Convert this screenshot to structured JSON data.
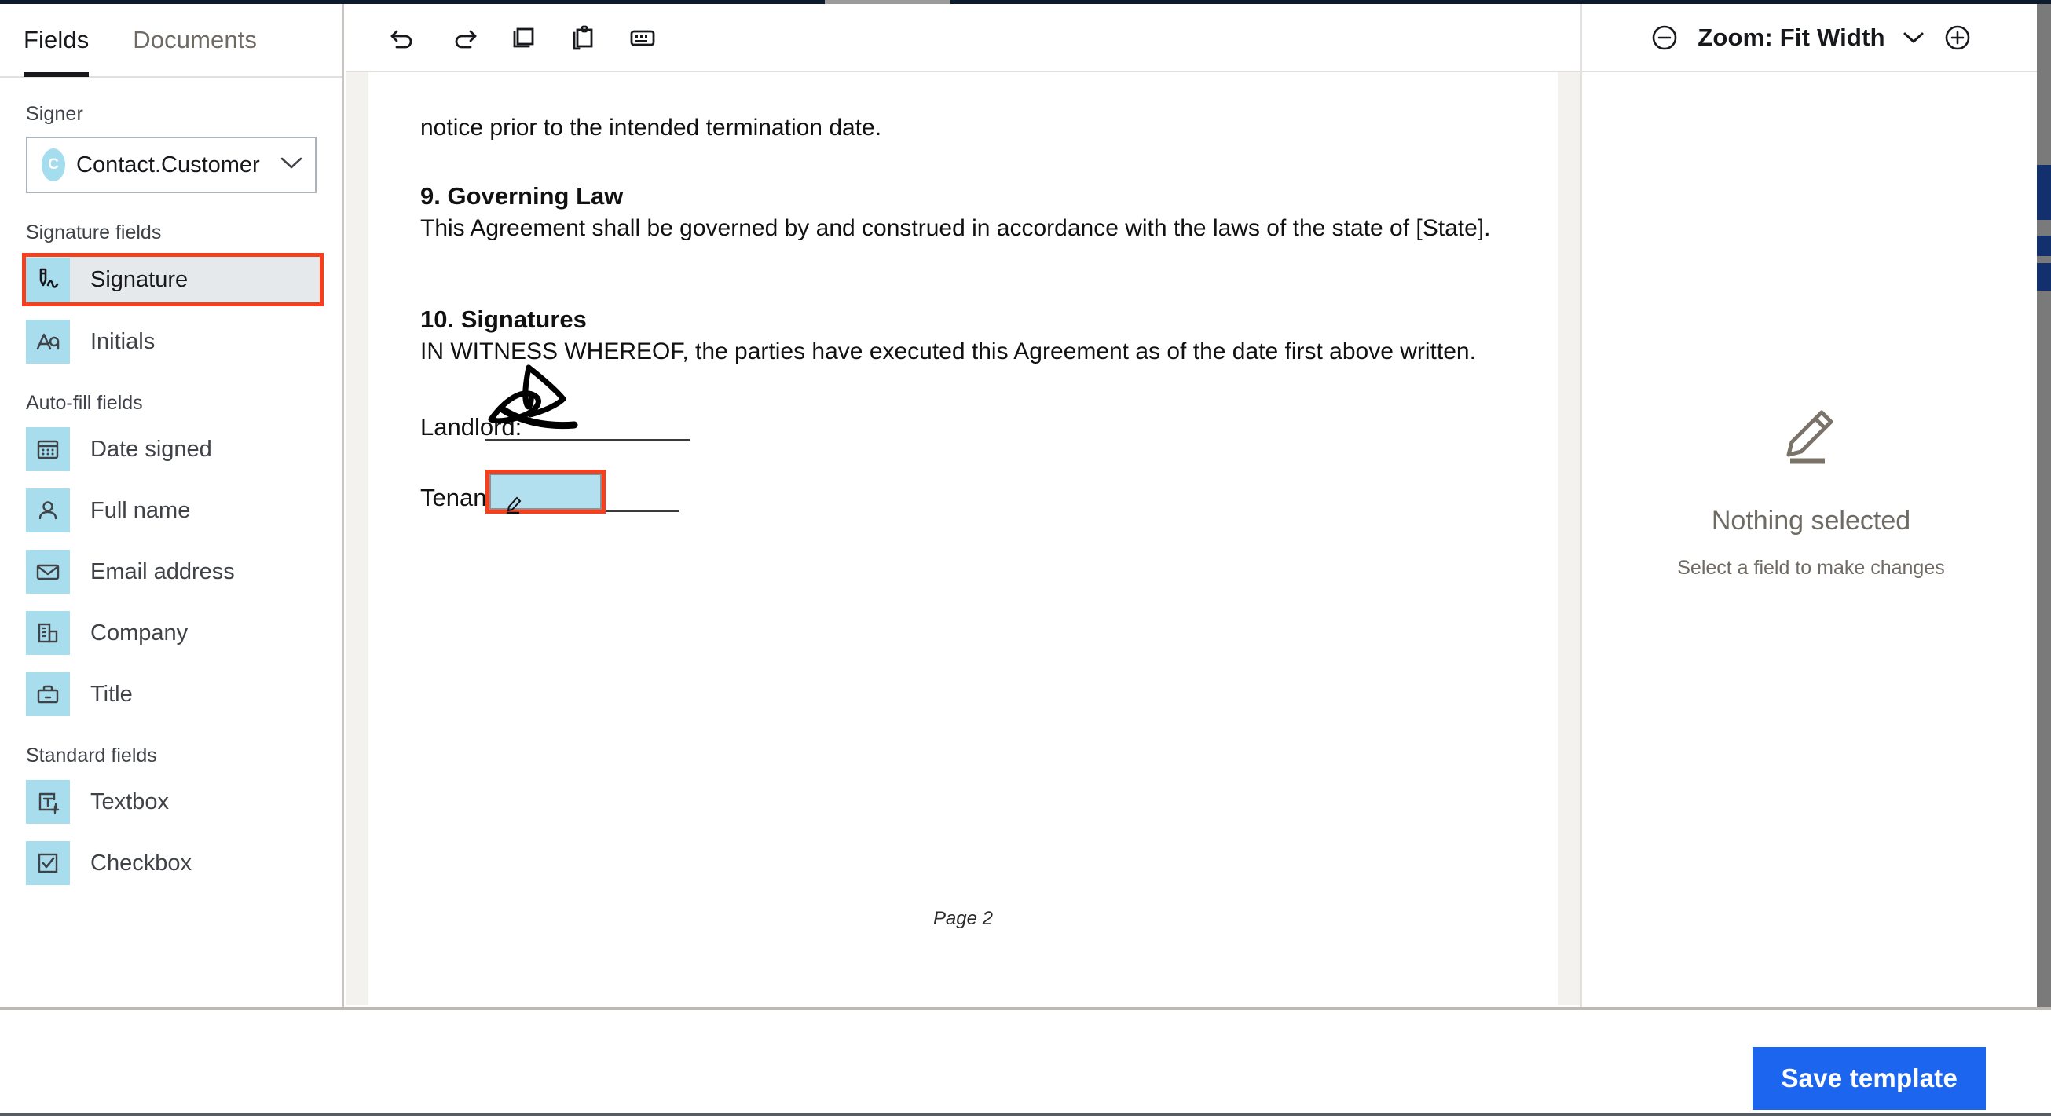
{
  "sidebar": {
    "tabs": [
      {
        "label": "Fields",
        "active": true
      },
      {
        "label": "Documents",
        "active": false
      }
    ],
    "signer_label": "Signer",
    "signer": {
      "avatar_initial": "C",
      "value": "Contact.Customer",
      "avatar_color": "#a3ddee"
    },
    "groups": [
      {
        "title": "Signature fields",
        "fields": [
          {
            "label": "Signature",
            "icon": "signature-icon",
            "selected": true
          },
          {
            "label": "Initials",
            "icon": "initials-icon",
            "selected": false
          }
        ]
      },
      {
        "title": "Auto-fill fields",
        "fields": [
          {
            "label": "Date signed",
            "icon": "calendar-icon",
            "selected": false
          },
          {
            "label": "Full name",
            "icon": "person-icon",
            "selected": false
          },
          {
            "label": "Email address",
            "icon": "envelope-icon",
            "selected": false
          },
          {
            "label": "Company",
            "icon": "building-icon",
            "selected": false
          },
          {
            "label": "Title",
            "icon": "briefcase-icon",
            "selected": false
          }
        ]
      },
      {
        "title": "Standard fields",
        "fields": [
          {
            "label": "Textbox",
            "icon": "textbox-icon",
            "selected": false
          },
          {
            "label": "Checkbox",
            "icon": "checkbox-icon",
            "selected": false
          }
        ]
      }
    ],
    "selection_highlight_color": "#f4401f",
    "field_icon_bg": "#a8ddee"
  },
  "toolbar": {
    "buttons": [
      {
        "name": "undo",
        "tooltip": "Undo"
      },
      {
        "name": "redo",
        "tooltip": "Redo"
      },
      {
        "name": "copy",
        "tooltip": "Copy"
      },
      {
        "name": "paste",
        "tooltip": "Paste"
      },
      {
        "name": "keyboard",
        "tooltip": "Keyboard shortcuts"
      }
    ]
  },
  "zoom": {
    "minus_label": "−",
    "plus_label": "+",
    "label": "Zoom: Fit Width"
  },
  "document": {
    "top_partial_line": "notice prior to the intended termination date.",
    "sections": [
      {
        "heading": "9. Governing Law",
        "body": "This Agreement shall be governed by and construed in accordance with the laws of the state of [State]."
      },
      {
        "heading": "10. Signatures",
        "body": "IN WITNESS WHEREOF, the parties have executed this Agreement as of the date first above written."
      }
    ],
    "signature_lines": [
      {
        "label": "Landlord:",
        "has_ink": true
      },
      {
        "label": "Tenant:",
        "has_ink": false,
        "has_field": true
      }
    ],
    "footer": "Page 2"
  },
  "right_panel": {
    "empty_icon": "pencil-underline-icon",
    "empty_title": "Nothing selected",
    "empty_subtitle": "Select a field to make changes"
  },
  "bottom_bar": {
    "save_label": "Save template",
    "save_color": "#1c66ef"
  }
}
